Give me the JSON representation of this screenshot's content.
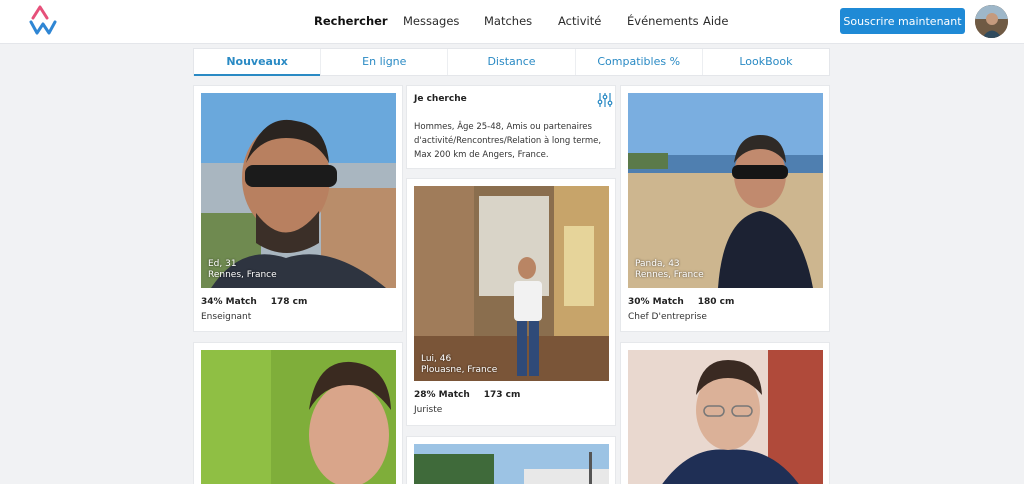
{
  "nav": {
    "items": [
      {
        "label": "Rechercher",
        "active": true
      },
      {
        "label": "Messages"
      },
      {
        "label": "Matches"
      },
      {
        "label": "Activité"
      },
      {
        "label": "Événements"
      },
      {
        "label": "Aide"
      }
    ],
    "subscribe_label": "Souscrire maintenant"
  },
  "tabs": [
    {
      "label": "Nouveaux",
      "active": true
    },
    {
      "label": "En ligne"
    },
    {
      "label": "Distance"
    },
    {
      "label": "Compatibles %"
    },
    {
      "label": "LookBook"
    }
  ],
  "search": {
    "title": "Je cherche",
    "description": "Hommes, Âge 25-48, Amis ou partenaires d'activité/Rencontres/Relation à long terme, Max 200 km de Angers, France."
  },
  "profiles": [
    {
      "name_age": "Ed, 31",
      "location": "Rennes, France",
      "match": "34% Match",
      "height": "178 cm",
      "job": "Enseignant"
    },
    {
      "name_age": "Lui, 46",
      "location": "Plouasne, France",
      "match": "28% Match",
      "height": "173 cm",
      "job": "Juriste"
    },
    {
      "name_age": "Panda, 43",
      "location": "Rennes, France",
      "match": "30% Match",
      "height": "180 cm",
      "job": "Chef D'entreprise"
    }
  ],
  "colors": {
    "accent": "#1f8ad6",
    "tab_text": "#2a8ac4",
    "logo_pink": "#e6507a",
    "logo_blue": "#2f86d4"
  }
}
